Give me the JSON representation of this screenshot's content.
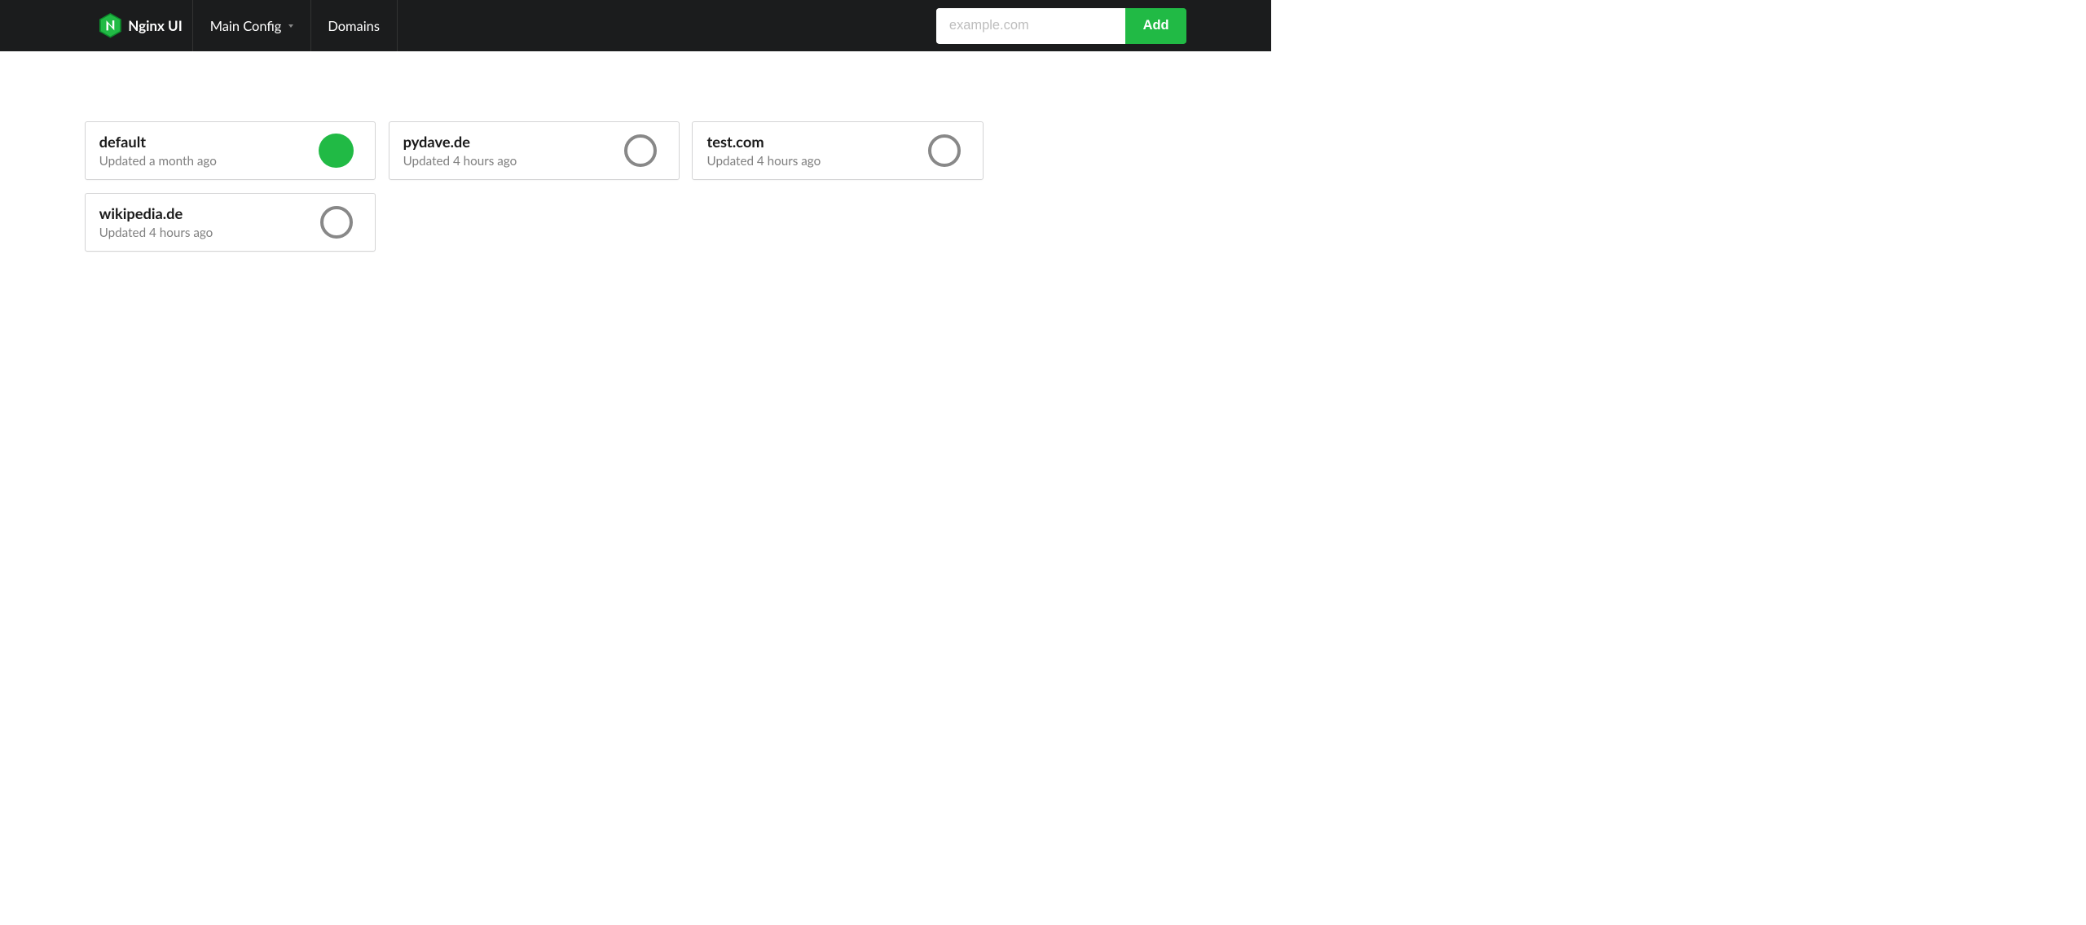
{
  "brand": {
    "name": "Nginx UI"
  },
  "nav": {
    "main_config": "Main Config",
    "domains": "Domains"
  },
  "add_form": {
    "placeholder": "example.com",
    "button_label": "Add"
  },
  "domain_cards": [
    {
      "name": "default",
      "updated": "Updated a month ago",
      "enabled": true
    },
    {
      "name": "pydave.de",
      "updated": "Updated 4 hours ago",
      "enabled": false
    },
    {
      "name": "test.com",
      "updated": "Updated 4 hours ago",
      "enabled": false
    },
    {
      "name": "wikipedia.de",
      "updated": "Updated 4 hours ago",
      "enabled": false
    }
  ]
}
